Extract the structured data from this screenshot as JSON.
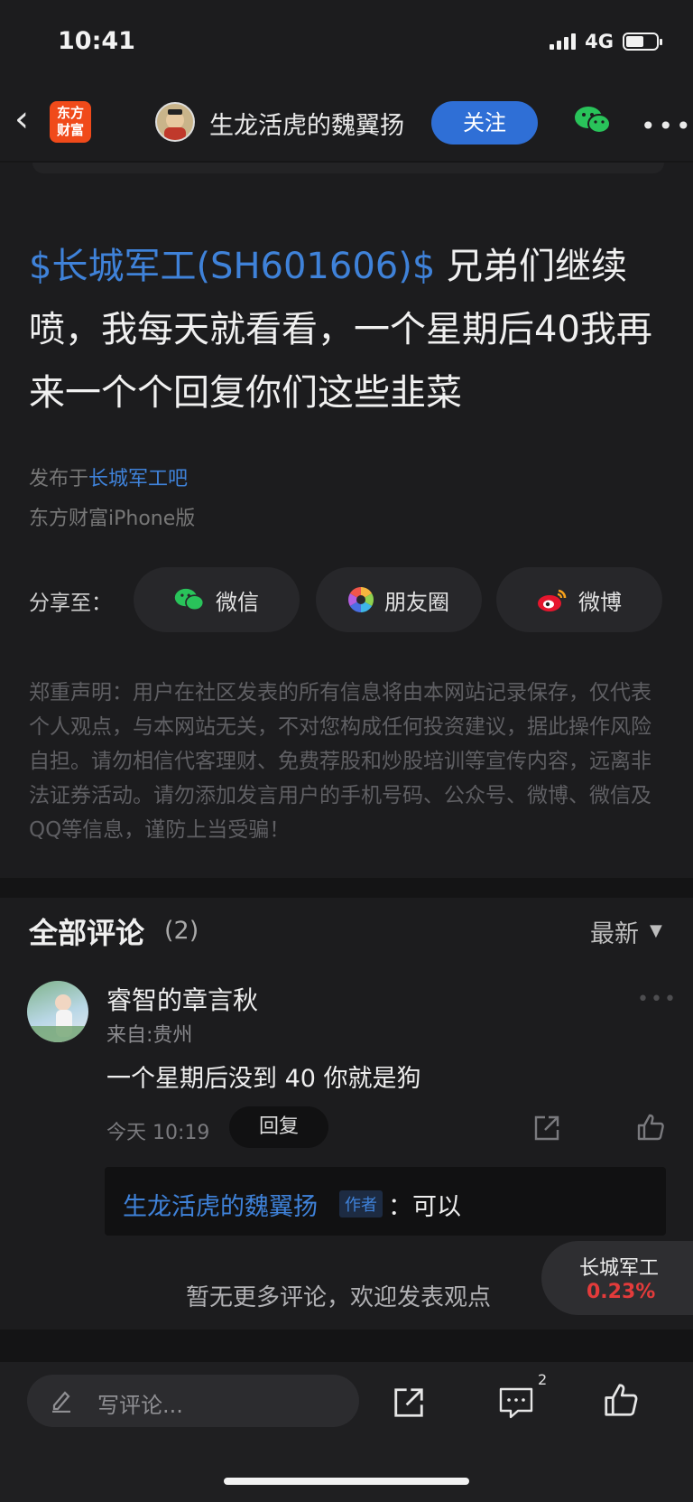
{
  "status_bar": {
    "time": "10:41",
    "network": "4G",
    "battery_level": 0.6
  },
  "nav": {
    "logo_line1": "东方",
    "logo_line2": "财富",
    "author_name": "生龙活虎的魏翼扬",
    "follow_label": "关注"
  },
  "post": {
    "stock_tag": "$长城军工(SH601606)$",
    "text": " 兄弟们继续喷，我每天就看看，一个星期后40我再来一个个回复你们这些韭菜",
    "published_prefix": "发布于",
    "published_board": "长城军工吧",
    "device": "东方财富iPhone版"
  },
  "share": {
    "label": "分享至：",
    "wechat": "微信",
    "moments": "朋友圈",
    "weibo": "微博"
  },
  "disclaimer": "郑重声明：用户在社区发表的所有信息将由本网站记录保存，仅代表个人观点，与本网站无关，不对您构成任何投资建议，据此操作风险自担。请勿相信代客理财、免费荐股和炒股培训等宣传内容，远离非法证券活动。请勿添加发言用户的手机号码、公众号、微博、微信及QQ等信息，谨防上当受骗！",
  "comments": {
    "title": "全部评论",
    "count": "(2)",
    "sort": "最新",
    "items": [
      {
        "user": "睿智的章言秋",
        "from": "来自:贵州",
        "text": "一个星期后没到 40 你就是狗",
        "time": "今天 10:19",
        "reply_label": "回复",
        "reply": {
          "author": "生龙活虎的魏翼扬",
          "tag": "作者",
          "text": "：可以"
        }
      }
    ],
    "no_more": "暂无更多评论，欢迎发表观点"
  },
  "floating_stock": {
    "name": "长城军工",
    "change": "0.23%"
  },
  "toolbar": {
    "write_placeholder": "写评论...",
    "comment_badge": "2"
  }
}
